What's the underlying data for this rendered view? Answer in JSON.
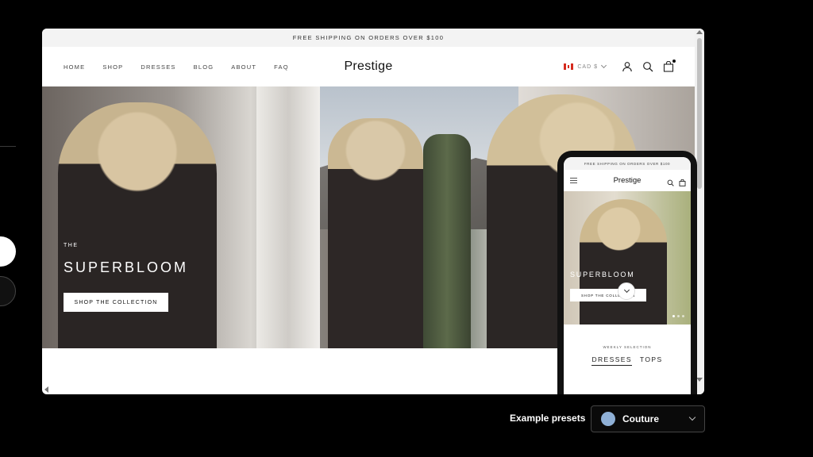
{
  "store": {
    "announcement": "FREE SHIPPING ON ORDERS OVER $100",
    "logo": "Prestige",
    "nav": [
      "HOME",
      "SHOP",
      "DRESSES",
      "BLOG",
      "ABOUT",
      "FAQ"
    ],
    "currency": "CAD $",
    "icons": [
      "flag-canada-icon",
      "account-icon",
      "search-icon",
      "cart-icon"
    ]
  },
  "hero": {
    "subtitle": "THE",
    "title": "SUPERBLOOM",
    "button": "SHOP THE COLLECTION"
  },
  "mobile": {
    "announcement": "FREE SHIPPING ON ORDERS OVER $100",
    "logo": "Prestige",
    "hero_title": "SUPERBLOOM",
    "hero_button": "SHOP THE COLLECTION",
    "section_label": "WEEKLY SELECTION",
    "tabs": [
      "DRESSES",
      "TOPS"
    ]
  },
  "presets": {
    "label": "Example presets",
    "selected": "Couture",
    "swatch_color": "#8fb0d6"
  }
}
